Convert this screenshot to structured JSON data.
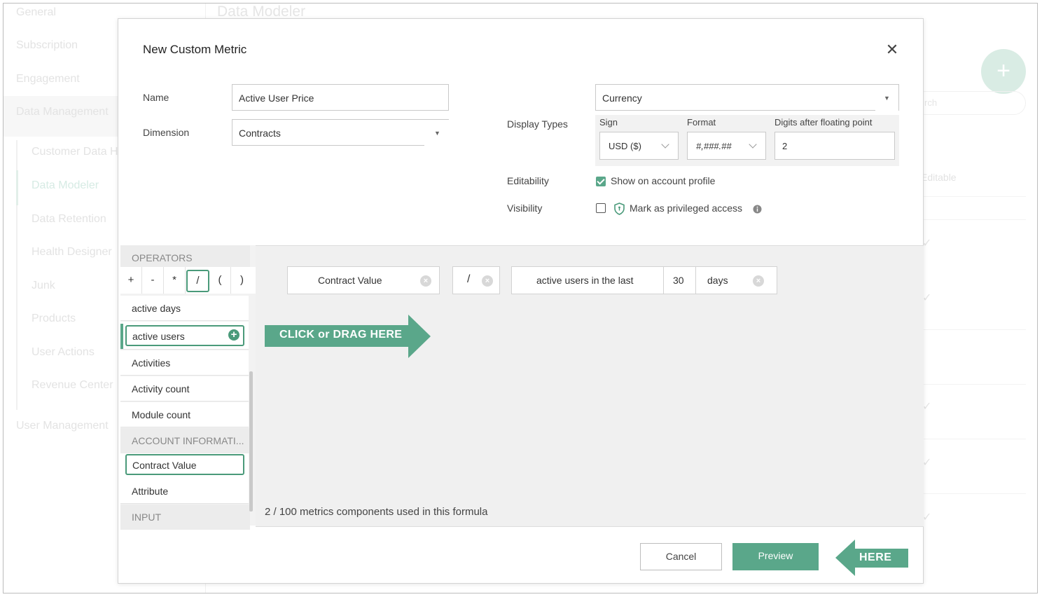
{
  "background": {
    "nav": [
      "General",
      "Subscription",
      "Engagement",
      "Data Management",
      "User Management"
    ],
    "sub_nav": [
      "Customer Data H",
      "Data Modeler",
      "Data Retention",
      "Health Designer",
      "Junk",
      "Products",
      "User Actions",
      "Revenue Center"
    ],
    "page_title": "Data Modeler",
    "fab_label": "+",
    "search_placeholder": "rch",
    "column_header": "Editable",
    "check_glyph": "✓"
  },
  "modal": {
    "title": "New Custom Metric",
    "close_glyph": "✕",
    "name_label": "Name",
    "name_value": "Active User Price",
    "dimension_label": "Dimension",
    "dimension_value": "Contracts",
    "display_types_label": "Display Types",
    "display_type_value": "Currency",
    "sign_label": "Sign",
    "sign_value": "USD ($)",
    "format_label": "Format",
    "format_value": "#,###.##",
    "digits_label": "Digits after floating point",
    "digits_value": "2",
    "editability_label": "Editability",
    "editability_checkbox_label": "Show on account profile",
    "editability_checked": true,
    "visibility_label": "Visibility",
    "visibility_checkbox_label": "Mark as privileged access",
    "visibility_checked": false,
    "caret_glyph": "▼"
  },
  "palette": {
    "operators_header": "OPERATORS",
    "operators": [
      "+",
      "-",
      "*",
      "/",
      "(",
      ")"
    ],
    "selected_operator": "/",
    "items": [
      "active days",
      "active users",
      "Activities",
      "Activity count",
      "Module count"
    ],
    "account_header": "ACCOUNT INFORMATI...",
    "account_items": [
      "Contract Value",
      "Attribute"
    ],
    "input_header": "INPUT",
    "plus_glyph": "+"
  },
  "formula": {
    "chip1": "Contract Value",
    "chip2": "/",
    "chip3_text": "active users in the last",
    "chip3_number": "30",
    "chip3_unit": "days",
    "remove_glyph": "×",
    "drop_hint": "CLICK or DRAG HERE",
    "usage": "2 / 100 metrics components used in this formula"
  },
  "footer": {
    "cancel_label": "Cancel",
    "preview_label": "Preview",
    "here_hint": "HERE"
  },
  "colors": {
    "accent": "#5aa78a",
    "accent_border": "#4a9a7a"
  }
}
